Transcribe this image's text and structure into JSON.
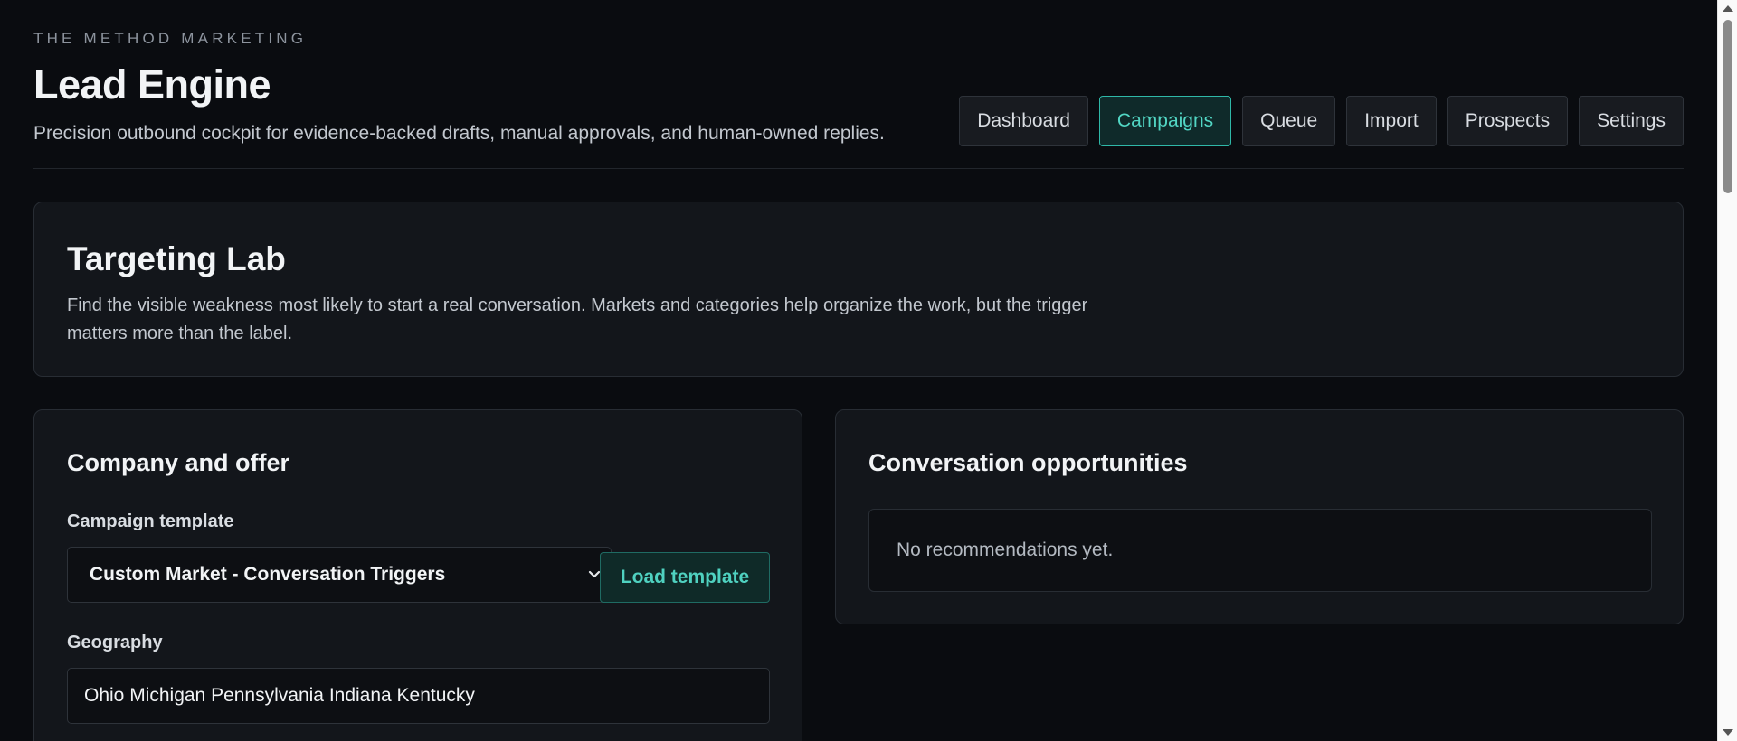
{
  "header": {
    "brand": "THE METHOD MARKETING",
    "title": "Lead Engine",
    "subtitle": "Precision outbound cockpit for evidence-backed drafts, manual approvals, and human-owned replies."
  },
  "nav": {
    "items": [
      {
        "label": "Dashboard",
        "active": false
      },
      {
        "label": "Campaigns",
        "active": true
      },
      {
        "label": "Queue",
        "active": false
      },
      {
        "label": "Import",
        "active": false
      },
      {
        "label": "Prospects",
        "active": false
      },
      {
        "label": "Settings",
        "active": false
      }
    ]
  },
  "hero": {
    "title": "Targeting Lab",
    "description": "Find the visible weakness most likely to start a real conversation. Markets and categories help organize the work, but the trigger matters more than the label."
  },
  "company_offer": {
    "title": "Company and offer",
    "template_label": "Campaign template",
    "template_value": "Custom Market - Conversation Triggers",
    "load_button": "Load template",
    "geography_label": "Geography",
    "geography_value": "Ohio Michigan Pennsylvania Indiana Kentucky"
  },
  "opportunities": {
    "title": "Conversation opportunities",
    "empty_text": "No recommendations yet."
  },
  "colors": {
    "background": "#0a0c10",
    "card": "#13161b",
    "accent": "#52d6c4"
  }
}
